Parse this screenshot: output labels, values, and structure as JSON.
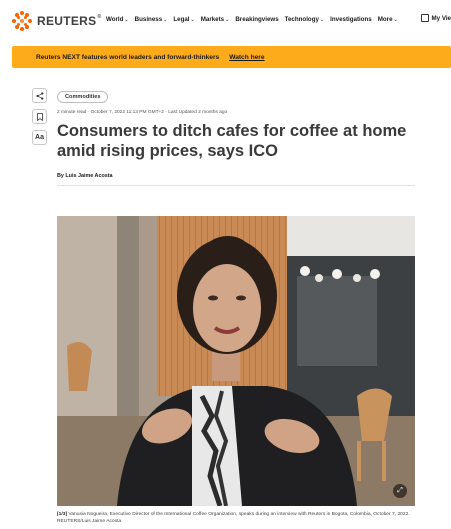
{
  "brand": {
    "name": "REUTERS",
    "reg": "®",
    "accent": "#fa6400"
  },
  "nav": {
    "items": [
      {
        "label": "World",
        "chevron": true
      },
      {
        "label": "Business",
        "chevron": true
      },
      {
        "label": "Legal",
        "chevron": true
      },
      {
        "label": "Markets",
        "chevron": true
      },
      {
        "label": "Breakingviews",
        "chevron": false
      },
      {
        "label": "Technology",
        "chevron": true
      },
      {
        "label": "Investigations",
        "chevron": false
      },
      {
        "label": "More",
        "chevron": true
      }
    ],
    "my_view": "My Vie"
  },
  "banner": {
    "text": "Reuters NEXT features world leaders and forward-thinkers",
    "link": "Watch here",
    "color": "#fdab1b"
  },
  "tools": {
    "share_icon": "share-icon",
    "bookmark_icon": "bookmark-icon",
    "text_size_label": "Aa"
  },
  "article": {
    "tag": "Commodities",
    "meta": "2 minute read · October 7, 2022 11:13 PM GMT+2 · Last Updated 2 months ago",
    "headline": "Consumers to ditch cafes for coffee at home amid rising prices, says ICO",
    "byline": "By Luis Jaime Acosta"
  },
  "photo": {
    "counter": "[1/3]",
    "caption": "Vanusia Nogueira, Executive Director of the International Coffee Organization, speaks during an interview with Reuters in Bogota, Colombia, October 7, 2022. REUTERS/Luis Jaime Acosta"
  }
}
